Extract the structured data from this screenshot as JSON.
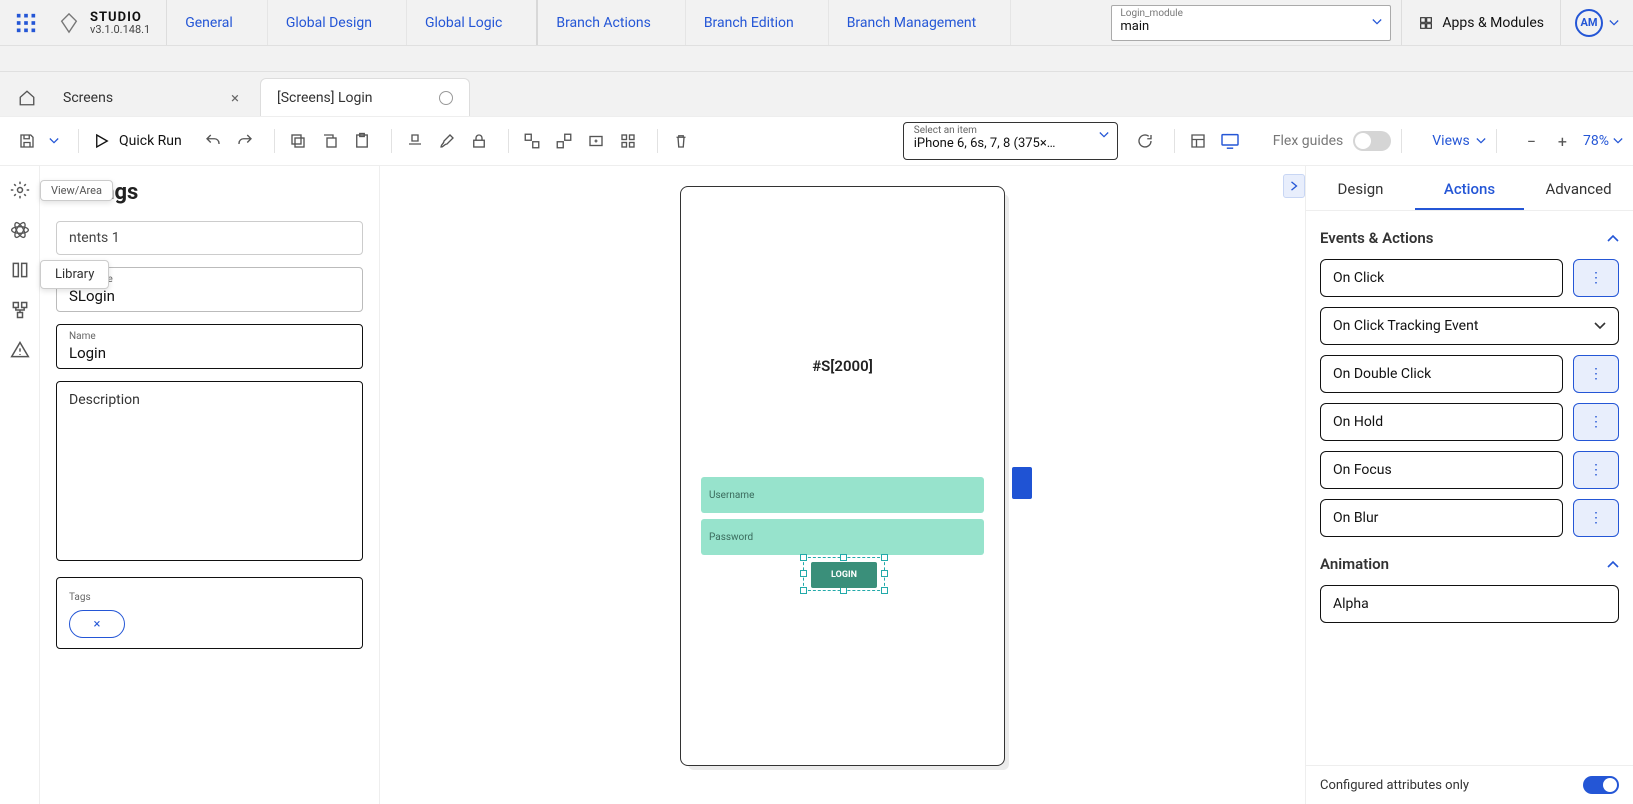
{
  "brand": {
    "name": "STUDIO",
    "version": "v3.1.0.148.1"
  },
  "topmenu": {
    "general": "General",
    "global_design": "Global Design",
    "global_logic": "Global Logic",
    "branch_actions": "Branch Actions",
    "branch_edition": "Branch Edition",
    "branch_management": "Branch Management"
  },
  "module_selector": {
    "sub": "Login_module",
    "main": "main"
  },
  "apps_modules": "Apps & Modules",
  "user_initials": "AM",
  "tabs": {
    "screens": "Screens",
    "login": "[Screens] Login"
  },
  "toolbar": {
    "quick_run": "Quick Run",
    "device_hint": "Select an item",
    "device_value": "iPhone 6, 6s, 7, 8 (375×…",
    "flex_guides": "Flex guides",
    "views": "Views",
    "zoom": "78%"
  },
  "tooltip_viewarea": "View/Area",
  "tooltip_library": "Library",
  "left_panel": {
    "title": "Settings",
    "contents_dropdown": "ntents 1",
    "sequence_label": "Sequence",
    "sequence_value": "SLogin",
    "name_label": "Name",
    "name_value": "Login",
    "description_label": "Description",
    "tags_label": "Tags",
    "tag_chip": "×"
  },
  "phone": {
    "title": "#S[2000]",
    "username_ph": "Username",
    "password_ph": "Password",
    "login_btn": "LOGIN"
  },
  "right_panel": {
    "tab_design": "Design",
    "tab_actions": "Actions",
    "tab_advanced": "Advanced",
    "section_events": "Events & Actions",
    "on_click": "On Click",
    "tracking": "On Click Tracking Event",
    "on_double_click": "On Double Click",
    "on_hold": "On Hold",
    "on_focus": "On Focus",
    "on_blur": "On Blur",
    "section_anim": "Animation",
    "alpha": "Alpha",
    "footer_label": "Configured attributes only"
  }
}
